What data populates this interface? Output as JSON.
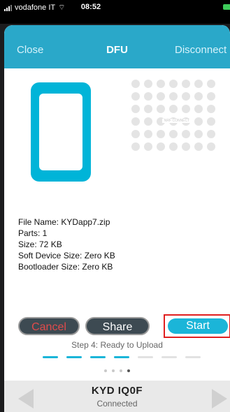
{
  "status_bar": {
    "carrier": "vodafone IT",
    "time": "08:52"
  },
  "navbar": {
    "close_label": "Close",
    "title": "DFU",
    "disconnect_label": "Disconnect"
  },
  "illustration": {
    "logo_text": "NRF CONNECT"
  },
  "file_info": {
    "file_name": "File Name: KYDapp7.zip",
    "parts": "Parts: 1",
    "size": "Size: 72 KB",
    "soft_device_size": "Soft Device Size: Zero KB",
    "bootloader_size": "Bootloader Size: Zero KB"
  },
  "actions": {
    "cancel_label": "Cancel",
    "share_label": "Share",
    "start_label": "Start"
  },
  "progress": {
    "step_text": "Step 4: Ready to Upload",
    "steps_total": 7,
    "steps_done": 4
  },
  "pager": {
    "pages": 4,
    "current": 4
  },
  "device": {
    "name": "KYD IQ0F",
    "status": "Connected"
  },
  "colors": {
    "accent": "#1bb5d8",
    "navbar": "#2aa8c9",
    "cancel_text": "#e14b4b",
    "highlight": "#e02020"
  }
}
